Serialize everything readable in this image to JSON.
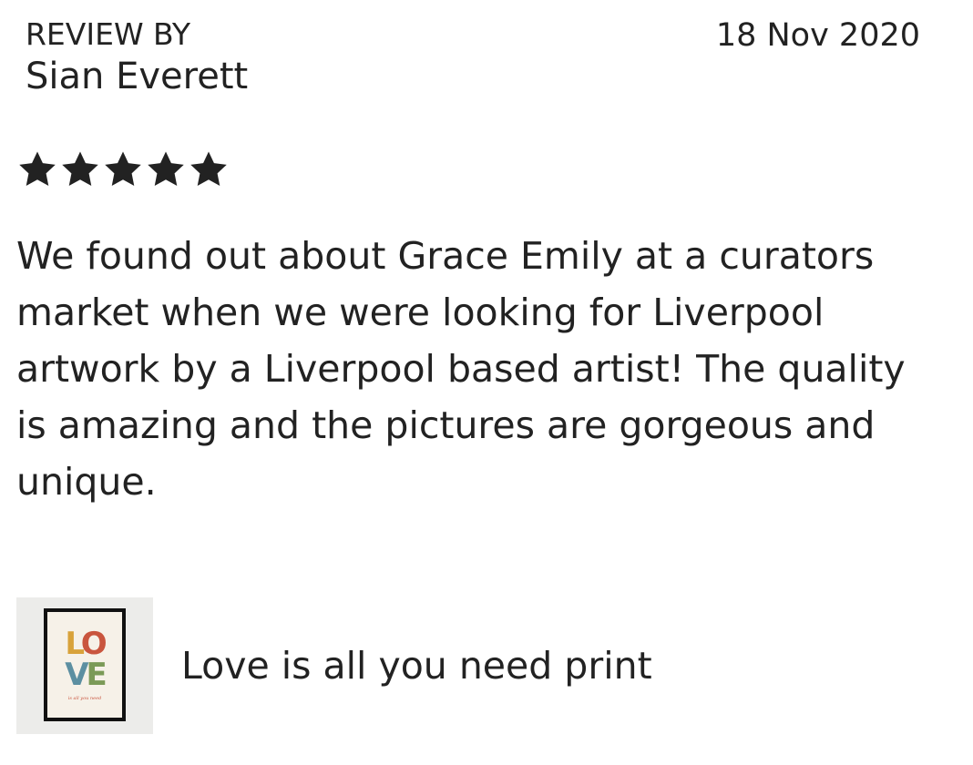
{
  "review": {
    "label": "REVIEW BY",
    "reviewer": "Sian Everett",
    "date": "18 Nov 2020",
    "rating": 5,
    "rating_max": 5,
    "text": "We found out about Grace Emily at a curators market when we were looking for Liverpool artwork by a Liverpool based artist! The quality is amazing and the pictures are gorgeous and unique."
  },
  "product": {
    "title": "Love is all you need print",
    "thumbnail": {
      "letters_row1": [
        "L",
        "O"
      ],
      "letters_row2": [
        "V",
        "E"
      ],
      "tagline": "is all you need"
    }
  },
  "colors": {
    "text": "#222222",
    "star": "#222222",
    "background": "#ffffff",
    "thumb_bg": "#ececea",
    "love_l": "#d8a23a",
    "love_o": "#c9553e",
    "love_v": "#5c8fa1",
    "love_e": "#7b9a57"
  },
  "icons": {
    "star": "star-icon"
  }
}
